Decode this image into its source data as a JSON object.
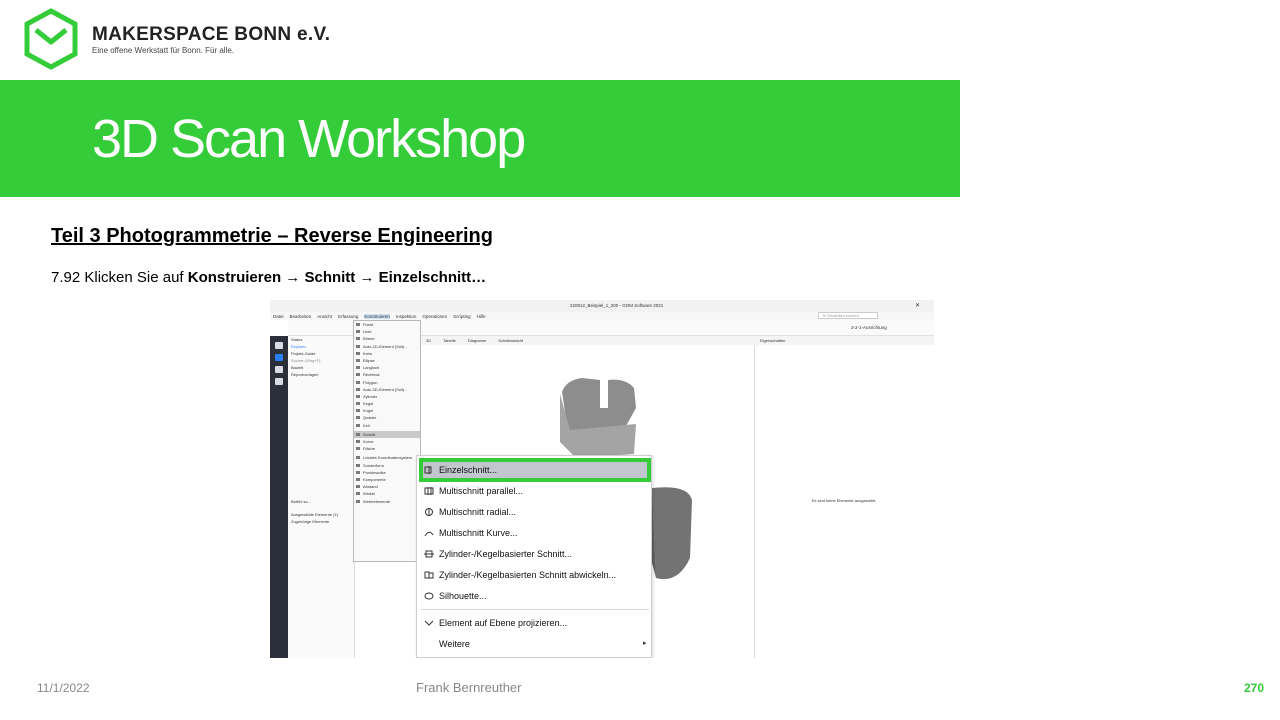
{
  "header": {
    "org_name": "MAKERSPACE BONN e.V.",
    "org_tagline": "Eine offene Werkstatt für Bonn. Für alle."
  },
  "banner": {
    "title": "3D Scan Workshop"
  },
  "content": {
    "subtitle": "Teil 3  Photogrammetrie  – Reverse Engineering",
    "instruction_prefix": "7.92 Klicken Sie auf ",
    "step1": "Konstruieren",
    "step2": "Schnitt",
    "step3": "Einzelschnitt…",
    "arrow": "→"
  },
  "screenshot": {
    "window_title": "220912_Beispiel_1_200 - GOM Software 2021",
    "menu_items": [
      "Datei",
      "Bearbeiten",
      "Ansicht",
      "Erfassung",
      "Konstruieren",
      "Inspektion",
      "Operationen",
      "Scripting",
      "Hilfe"
    ],
    "search_placeholder": "In Einstellen suchen",
    "alignment_label": "3-2-1-Ausrichtung",
    "left_panel": {
      "status_label": "Status",
      "tabs": [
        "Explorer",
        "Projekt-Guide"
      ],
      "search": "Suchen (Strg+F)",
      "tree": [
        "Bauteil",
        "Reportvorlagen"
      ],
      "bottom_tab": "Befehl su...",
      "bottom_items": [
        "Ausgewählte Elemente (1)",
        "Zugehörige Elemente"
      ]
    },
    "center_tabs": [
      "3D",
      "Tabelle",
      "Diagramm",
      "Schnittansicht"
    ],
    "right_tab": "Eigenschaften",
    "right_empty": "Es sind keine Elemente ausgewählt.",
    "construct_menu": [
      "Punkt",
      "Linie",
      "Ebene",
      "Auto-2D-Element (Soll)...",
      "Kreis",
      "Ellipse",
      "Langloch",
      "Rechteck",
      "Polygon",
      "Auto-3D-Element (Soll)...",
      "Zylinder",
      "Kegel",
      "Kugel",
      "Quader",
      "Keil",
      "Schnitt",
      "Kurve",
      "Fläche",
      "Lokales Koordinatensystem",
      "Sonderform",
      "Punktewolke",
      "Komponente",
      "Abstand",
      "Winkel",
      "Werteelemente"
    ],
    "construct_selected": "Schnitt",
    "submenu": [
      "Einzelschnitt...",
      "Multischnitt parallel...",
      "Multischnitt radial...",
      "Multischnitt Kurve...",
      "Zylinder-/Kegelbasierter Schnitt...",
      "Zylinder-/Kegelbasierten Schnitt abwickeln...",
      "Silhouette...",
      "Element auf Ebene projizieren...",
      "Weitere"
    ],
    "submenu_selected": "Einzelschnitt..."
  },
  "footer": {
    "date": "11/1/2022",
    "author": "Frank Bernreuther",
    "page": "270"
  },
  "colors": {
    "accent": "#35cc3a"
  }
}
